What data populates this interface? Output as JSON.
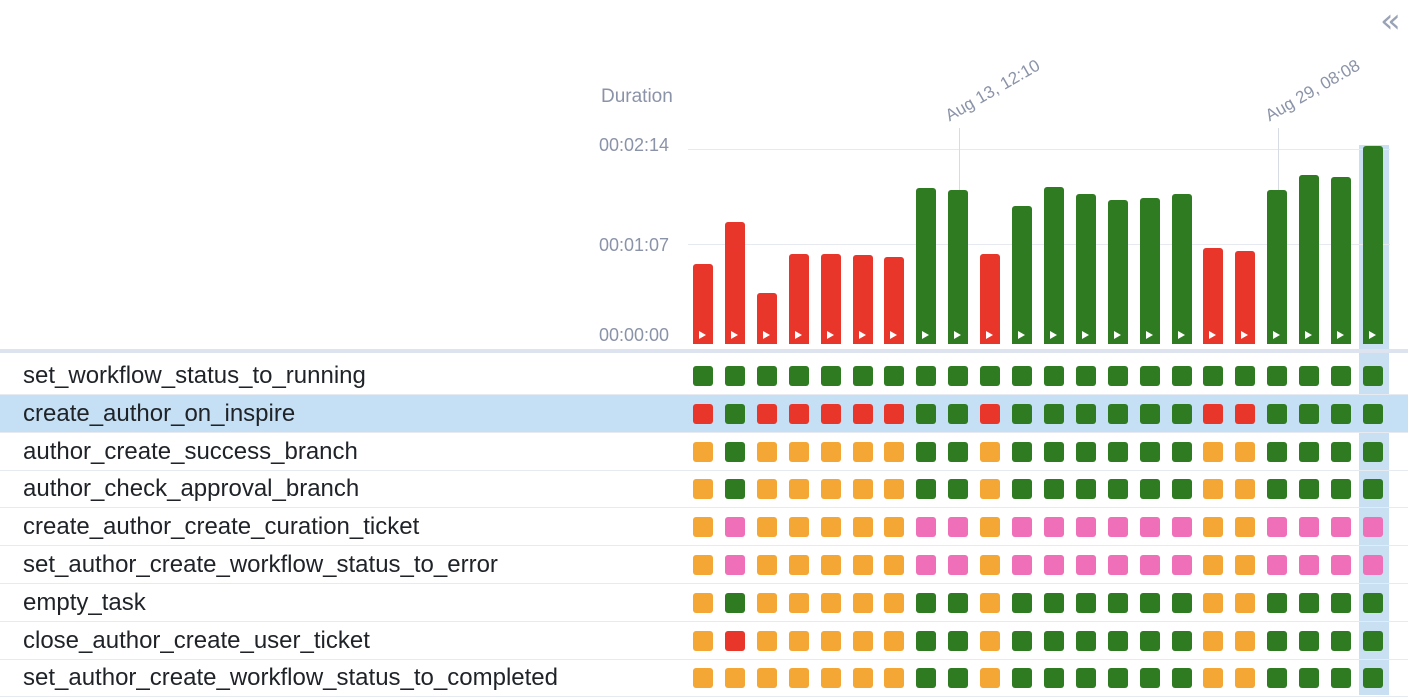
{
  "header": {
    "collapse_icon": "double-chevron-left-icon",
    "collapse_glyph": "«",
    "duration_label": "Duration"
  },
  "chart_data": {
    "type": "bar",
    "ylabel": "Duration",
    "y_ticks": [
      "00:00:00",
      "00:01:07",
      "00:02:14"
    ],
    "ylim": [
      0,
      134
    ],
    "x_date_labels": [
      "Aug 13, 12:10",
      "Aug 29, 08:08"
    ],
    "grid": true,
    "values": [
      55,
      84,
      35,
      62,
      62,
      61,
      60,
      107,
      106,
      62,
      95,
      108,
      103,
      99,
      100,
      103,
      66,
      64,
      106,
      116,
      115,
      136
    ],
    "states": [
      "failed",
      "failed",
      "failed",
      "failed",
      "failed",
      "failed",
      "failed",
      "success",
      "success",
      "failed",
      "success",
      "success",
      "success",
      "success",
      "success",
      "success",
      "failed",
      "failed",
      "success",
      "success",
      "success",
      "success"
    ],
    "colors": {
      "success": "#2f7b22",
      "failed": "#e8362b",
      "upstream_failed": "#f4a735",
      "skipped": "#ef6fb8"
    },
    "selected_index": 21
  },
  "tasks": [
    {
      "name": "set_workflow_status_to_running",
      "states": [
        "success",
        "success",
        "success",
        "success",
        "success",
        "success",
        "success",
        "success",
        "success",
        "success",
        "success",
        "success",
        "success",
        "success",
        "success",
        "success",
        "success",
        "success",
        "success",
        "success",
        "success",
        "success"
      ]
    },
    {
      "name": "create_author_on_inspire",
      "selected": true,
      "states": [
        "failed",
        "success",
        "failed",
        "failed",
        "failed",
        "failed",
        "failed",
        "success",
        "success",
        "failed",
        "success",
        "success",
        "success",
        "success",
        "success",
        "success",
        "failed",
        "failed",
        "success",
        "success",
        "success",
        "success"
      ]
    },
    {
      "name": "author_create_success_branch",
      "states": [
        "upstream_failed",
        "success",
        "upstream_failed",
        "upstream_failed",
        "upstream_failed",
        "upstream_failed",
        "upstream_failed",
        "success",
        "success",
        "upstream_failed",
        "success",
        "success",
        "success",
        "success",
        "success",
        "success",
        "upstream_failed",
        "upstream_failed",
        "success",
        "success",
        "success",
        "success"
      ]
    },
    {
      "name": "author_check_approval_branch",
      "states": [
        "upstream_failed",
        "success",
        "upstream_failed",
        "upstream_failed",
        "upstream_failed",
        "upstream_failed",
        "upstream_failed",
        "success",
        "success",
        "upstream_failed",
        "success",
        "success",
        "success",
        "success",
        "success",
        "success",
        "upstream_failed",
        "upstream_failed",
        "success",
        "success",
        "success",
        "success"
      ]
    },
    {
      "name": "create_author_create_curation_ticket",
      "states": [
        "upstream_failed",
        "skipped",
        "upstream_failed",
        "upstream_failed",
        "upstream_failed",
        "upstream_failed",
        "upstream_failed",
        "skipped",
        "skipped",
        "upstream_failed",
        "skipped",
        "skipped",
        "skipped",
        "skipped",
        "skipped",
        "skipped",
        "upstream_failed",
        "upstream_failed",
        "skipped",
        "skipped",
        "skipped",
        "skipped"
      ]
    },
    {
      "name": "set_author_create_workflow_status_to_error",
      "states": [
        "upstream_failed",
        "skipped",
        "upstream_failed",
        "upstream_failed",
        "upstream_failed",
        "upstream_failed",
        "upstream_failed",
        "skipped",
        "skipped",
        "upstream_failed",
        "skipped",
        "skipped",
        "skipped",
        "skipped",
        "skipped",
        "skipped",
        "upstream_failed",
        "upstream_failed",
        "skipped",
        "skipped",
        "skipped",
        "skipped"
      ]
    },
    {
      "name": "empty_task",
      "states": [
        "upstream_failed",
        "success",
        "upstream_failed",
        "upstream_failed",
        "upstream_failed",
        "upstream_failed",
        "upstream_failed",
        "success",
        "success",
        "upstream_failed",
        "success",
        "success",
        "success",
        "success",
        "success",
        "success",
        "upstream_failed",
        "upstream_failed",
        "success",
        "success",
        "success",
        "success"
      ]
    },
    {
      "name": "close_author_create_user_ticket",
      "states": [
        "upstream_failed",
        "failed",
        "upstream_failed",
        "upstream_failed",
        "upstream_failed",
        "upstream_failed",
        "upstream_failed",
        "success",
        "success",
        "upstream_failed",
        "success",
        "success",
        "success",
        "success",
        "success",
        "success",
        "upstream_failed",
        "upstream_failed",
        "success",
        "success",
        "success",
        "success"
      ]
    },
    {
      "name": "set_author_create_workflow_status_to_completed",
      "states": [
        "upstream_failed",
        "upstream_failed",
        "upstream_failed",
        "upstream_failed",
        "upstream_failed",
        "upstream_failed",
        "upstream_failed",
        "success",
        "success",
        "upstream_failed",
        "success",
        "success",
        "success",
        "success",
        "success",
        "success",
        "upstream_failed",
        "upstream_failed",
        "success",
        "success",
        "success",
        "success"
      ]
    }
  ]
}
